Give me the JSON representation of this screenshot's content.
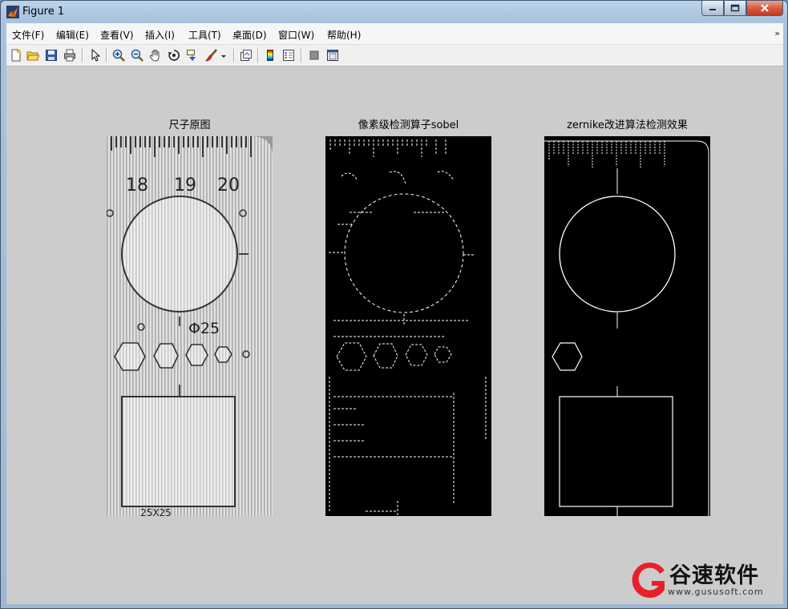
{
  "window": {
    "title": "Figure 1"
  },
  "menu": [
    {
      "label": "文件(F)"
    },
    {
      "label": "编辑(E)"
    },
    {
      "label": "查看(V)"
    },
    {
      "label": "插入(I)"
    },
    {
      "label": "工具(T)"
    },
    {
      "label": "桌面(D)"
    },
    {
      "label": "窗口(W)"
    },
    {
      "label": "帮助(H)"
    }
  ],
  "toolbar_icons": [
    "new-figure-icon",
    "open-file-icon",
    "save-icon",
    "print-icon",
    "edit-plot-arrow-icon",
    "zoom-in-icon",
    "zoom-out-icon",
    "pan-hand-icon",
    "rotate-3d-icon",
    "data-cursor-icon",
    "brush-icon",
    "link-plot-icon",
    "insert-colorbar-icon",
    "insert-legend-icon",
    "hide-plot-tools-icon",
    "show-plot-tools-icon"
  ],
  "axes": [
    {
      "title": "尺子原图",
      "ruler_numbers": [
        "18",
        "19",
        "20"
      ],
      "diameter_label": "Φ25",
      "square_label": "25X25"
    },
    {
      "title": "像素级检测算子sobel"
    },
    {
      "title": "zernike改进算法检测效果"
    }
  ],
  "watermark": {
    "text": "谷速软件",
    "url": "www.gususoft.com",
    "brand_color": "#e8202a"
  }
}
